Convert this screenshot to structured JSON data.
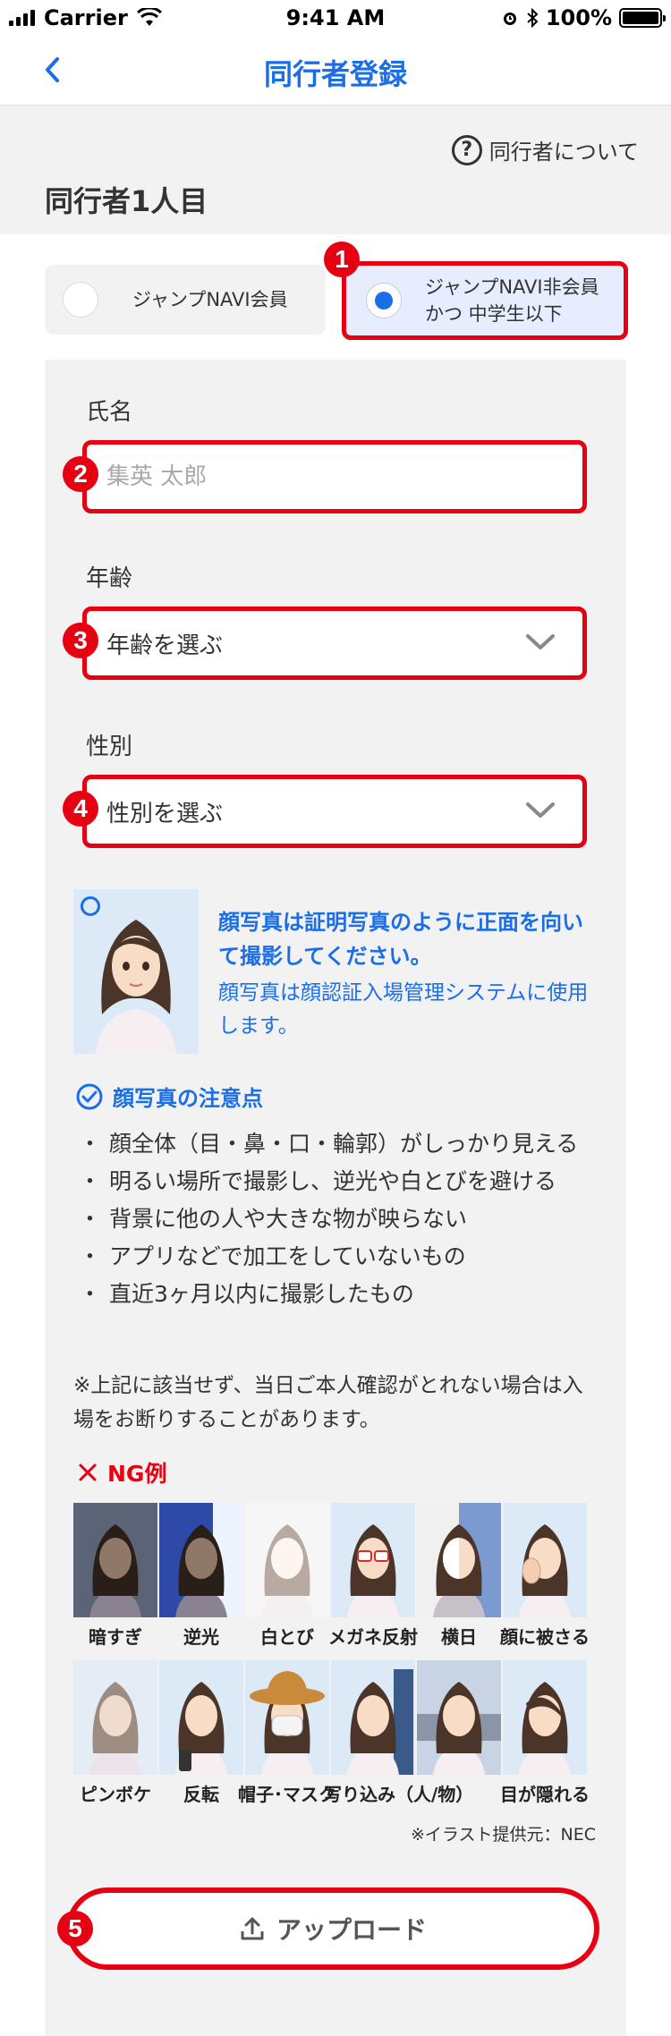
{
  "status_bar": {
    "carrier": "Carrier",
    "time": "9:41 AM",
    "battery": "100%"
  },
  "nav": {
    "title": "同行者登録",
    "back_icon": "chevron-left-icon"
  },
  "help": {
    "label": "同行者について",
    "icon": "question-circle-icon"
  },
  "section_title": "同行者1人目",
  "member_options": [
    {
      "label": "ジャンプNAVI会員",
      "selected": false
    },
    {
      "label_line1": "ジャンプNAVI非会員",
      "label_line2": "かつ 中学生以下",
      "selected": true
    }
  ],
  "form": {
    "name_label": "氏名",
    "name_placeholder": "集英 太郎",
    "age_label": "年齢",
    "age_value": "年齢を選ぶ",
    "gender_label": "性別",
    "gender_value": "性別を選ぶ"
  },
  "photo_guide": {
    "heading": "顔写真は証明写真のように正面を向いて撮影してください。",
    "description": "顔写真は顔認証入場管理システムに使用します。"
  },
  "notes": {
    "heading": "顔写真の注意点",
    "items": [
      "顔全体（目・鼻・口・輪郭）がしっかり見える",
      "明るい場所で撮影し、逆光や白とびを避ける",
      "背景に他の人や大きな物が映らない",
      "アプリなどで加工をしていないもの",
      "直近3ヶ月以内に撮影したもの"
    ],
    "disclaimer": "※上記に該当せず、当日ご本人確認がとれない場合は入場をお断りすることがあります。"
  },
  "ng_examples": {
    "heading": "NG例",
    "row1": [
      "暗すぎ",
      "逆光",
      "白とび",
      "メガネ反射",
      "横日",
      "顔に被さる"
    ],
    "row2": [
      "ピンボケ",
      "反転",
      "帽子･マスク",
      "写り込み（人/物）",
      "目が隠れる"
    ],
    "credit": "※イラスト提供元：NEC"
  },
  "upload": {
    "label": "アップロード",
    "icon": "upload-icon"
  },
  "annotations": [
    "1",
    "2",
    "3",
    "4",
    "5"
  ],
  "colors": {
    "accent": "#1a6ee8",
    "highlight": "#e60012"
  }
}
